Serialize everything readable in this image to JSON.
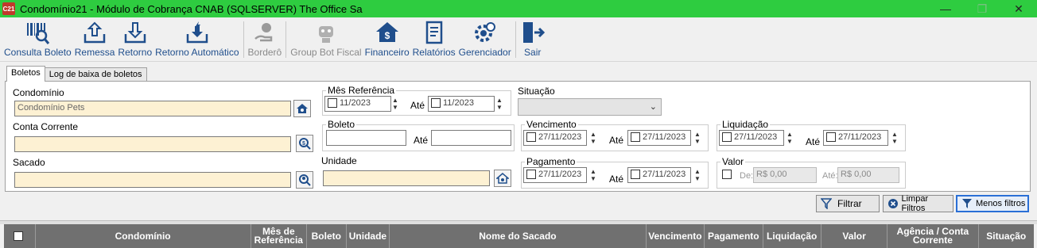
{
  "window": {
    "icon_text": "C21",
    "title": "Condomínio21 - Módulo de Cobrança CNAB (SQLSERVER)  The Office Sa",
    "minimize": "—",
    "maximize": "❐",
    "close": "✕"
  },
  "toolbar": {
    "consulta_boleto": "Consulta Boleto",
    "remessa": "Remessa",
    "retorno": "Retorno",
    "retorno_automatico": "Retorno Automático",
    "bordero": "Borderô",
    "group_bot_fiscal": "Group Bot Fiscal",
    "financeiro": "Financeiro",
    "relatorios": "Relatórios",
    "gerenciador": "Gerenciador",
    "sair": "Sair"
  },
  "tabs": [
    "Boletos",
    "Log de baixa de boletos"
  ],
  "filters": {
    "condominio_label": "Condomínio",
    "condominio_value": "Condomínio Pets",
    "conta_corrente_label": "Conta Corrente",
    "conta_corrente_value": "",
    "sacado_label": "Sacado",
    "sacado_value": "",
    "mes_referencia_label": "Mês Referência",
    "mes_ref_from": "11/2023",
    "mes_ref_to": "11/2023",
    "ate": "Até",
    "situacao_label": "Situação",
    "situacao_value": "",
    "boleto_label": "Boleto",
    "boleto_from": "",
    "boleto_to": "",
    "vencimento_label": "Vencimento",
    "vencimento_from": "27/11/2023",
    "vencimento_to": "27/11/2023",
    "liquidacao_label": "Liquidação",
    "liquidacao_from": "27/11/2023",
    "liquidacao_to": "27/11/2023",
    "unidade_label": "Unidade",
    "unidade_value": "",
    "pagamento_label": "Pagamento",
    "pagamento_from": "27/11/2023",
    "pagamento_to": "27/11/2023",
    "valor_label": "Valor",
    "valor_de_label": "De:",
    "valor_de": "R$ 0,00",
    "valor_ate_label": "Até:",
    "valor_ate": "R$ 0,00"
  },
  "actions": {
    "filtrar": "Filtrar",
    "limpar_filtros": "Limpar Filtros",
    "menos_filtros": "Menos filtros"
  },
  "grid": {
    "columns": [
      "Condomínio",
      "Mês de Referência",
      "Boleto",
      "Unidade",
      "Nome do Sacado",
      "Vencimento",
      "Pagamento",
      "Liquidação",
      "Valor",
      "Agência / Conta Corrente",
      "Situação"
    ]
  },
  "colors": {
    "titlebar": "#2ecc40",
    "toolbar_text": "#1f4e8c",
    "input_yellow": "#fdf1d3",
    "grid_header": "#707070"
  }
}
